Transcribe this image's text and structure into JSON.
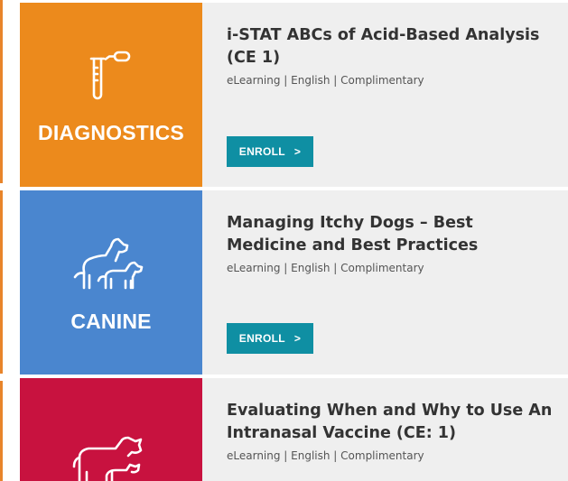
{
  "courses": [
    {
      "category": "DIAGNOSTICS",
      "tile_color": "#ec8a1c",
      "icon": "test-tube-dropper-icon",
      "title": "i-STAT ABCs of Acid-Based Analysis (CE 1)",
      "meta": "eLearning | English | Complimentary",
      "enroll_label": "ENROLL",
      "enroll_chevron": ">"
    },
    {
      "category": "CANINE",
      "tile_color": "#4a86cf",
      "icon": "dogs-icon",
      "title": "Managing Itchy Dogs – Best Medicine and Best Practices",
      "meta": "eLearning | English | Complimentary",
      "enroll_label": "ENROLL",
      "enroll_chevron": ">"
    },
    {
      "category": "",
      "tile_color": "#c8123f",
      "icon": "cow-and-calf-icon",
      "title": "Evaluating When and Why to Use An Intranasal Vaccine (CE: 1)",
      "meta": "eLearning | English | Complimentary"
    }
  ],
  "colors": {
    "card_background": "#efefef",
    "button": "#0f8fa3",
    "edge_accent": "#e8842a"
  }
}
